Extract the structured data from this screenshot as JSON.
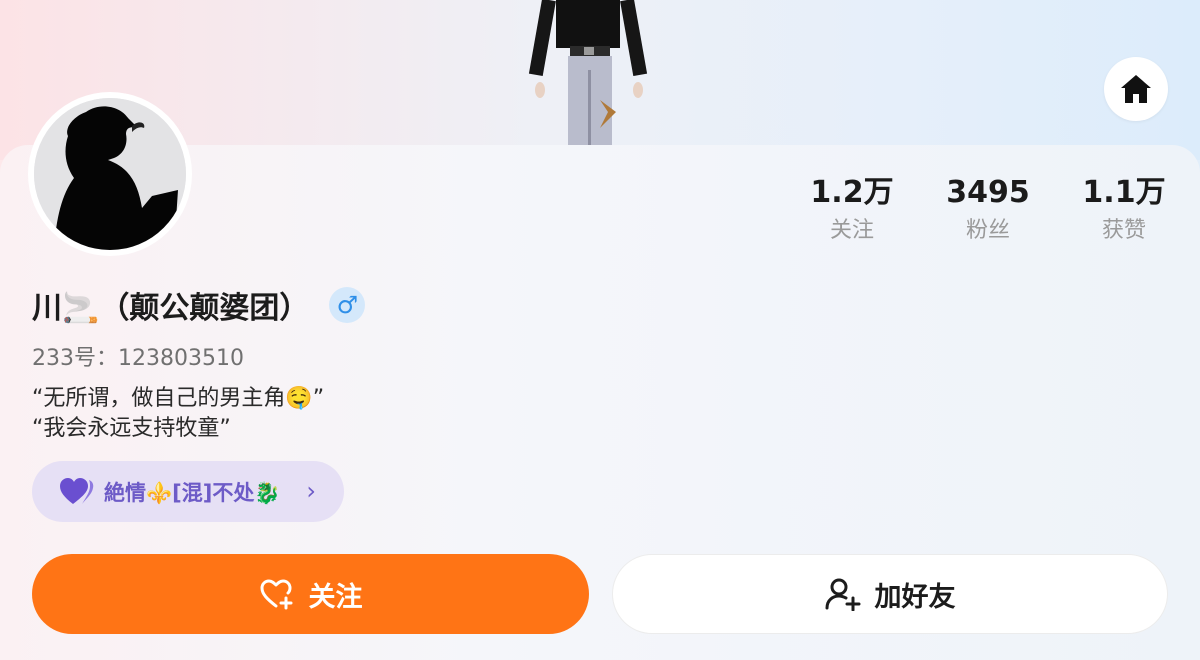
{
  "header": {
    "home_icon": "home-icon"
  },
  "profile": {
    "name": "川🚬（颠公颠婆团）",
    "gender_symbol": "♂",
    "uid_label": "233号：",
    "uid_value": "123803510",
    "bio_line1": "“无所谓，做自己的男主角🤤”",
    "bio_line2": "“我会永远支持牧童”"
  },
  "stats": [
    {
      "value": "1.2万",
      "label": "关注"
    },
    {
      "value": "3495",
      "label": "粉丝"
    },
    {
      "value": "1.1万",
      "label": "获赞"
    }
  ],
  "tag": {
    "label": "絶情⚜️[混]不处🐉",
    "icon": "purple-hearts-icon",
    "chevron": "›"
  },
  "actions": {
    "follow_label": "关注",
    "follow_icon": "heart-plus-icon",
    "add_friend_label": "加好友",
    "add_friend_icon": "user-plus-icon"
  },
  "colors": {
    "follow_button": "#ff7415",
    "tag_background": "#e6e0f5",
    "tag_text": "#6d5bc7",
    "gender_badge": "#d4e8fb"
  }
}
